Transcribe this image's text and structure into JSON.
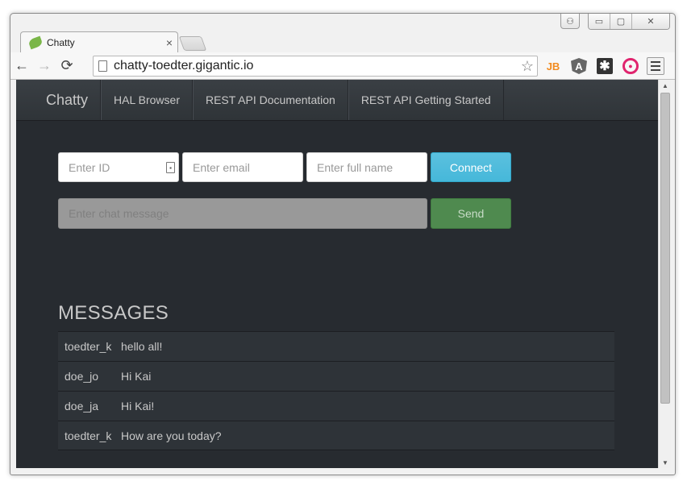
{
  "browser": {
    "tab_title": "Chatty",
    "tab_close": "×",
    "url": "chatty-toedter.gigantic.io",
    "back_icon": "←",
    "forward_icon": "→",
    "reload_icon": "⟳",
    "star_icon": "☆",
    "extensions": {
      "jb": "JB",
      "angular": "A",
      "asterisk": "✱",
      "eye": "●"
    },
    "window_controls": {
      "minimize": "▭",
      "maximize": "▢",
      "close": "✕"
    }
  },
  "site": {
    "brand": "Chatty",
    "nav_links": [
      "HAL Browser",
      "REST API Documentation",
      "REST API Getting Started"
    ]
  },
  "form": {
    "id_placeholder": "Enter ID",
    "email_placeholder": "Enter email",
    "fullname_placeholder": "Enter full name",
    "connect_label": "Connect",
    "message_placeholder": "Enter chat message",
    "send_label": "Send"
  },
  "messages": {
    "title": "MESSAGES",
    "rows": [
      {
        "user": "toedter_k",
        "text": "hello all!"
      },
      {
        "user": "doe_jo",
        "text": "Hi Kai"
      },
      {
        "user": "doe_ja",
        "text": "Hi Kai!"
      },
      {
        "user": "toedter_k",
        "text": "How are you today?"
      }
    ]
  },
  "colors": {
    "page_background": "#272b30",
    "navbar": "#3a3f44",
    "connect_button": "#5bc0de",
    "send_button": "#4f8a4f"
  }
}
